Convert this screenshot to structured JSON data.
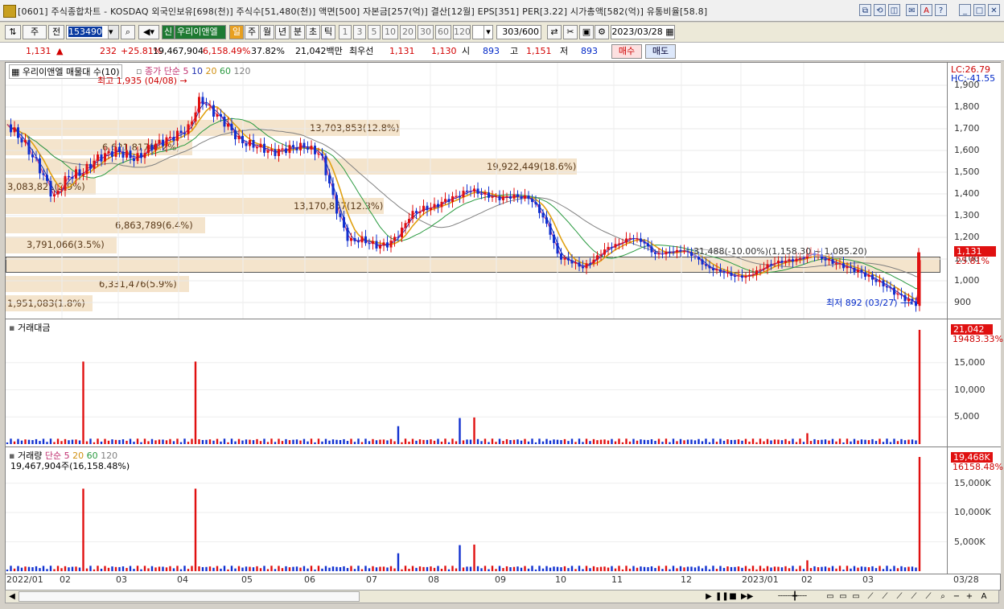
{
  "window": {
    "title": "[0601] 주식종합차트 - KOSDAQ 외국인보유[698(천)] 주식수[51,480(천)] 액면[500] 자본금[257(억)] 결산[12월] EPS[351] PER[3.22] 시가총액[582(억)] 유통비율[58.8]",
    "buttons": [
      "⧉",
      "⟲",
      "◫",
      "✉",
      "A",
      "?",
      "_",
      "□",
      "✕"
    ]
  },
  "toolbar": {
    "market": "주",
    "prev": "전",
    "code": "153490",
    "stock_name": "우리이앤엘",
    "new_badge": "신",
    "periods": [
      "일",
      "주",
      "월",
      "년",
      "분",
      "초",
      "틱"
    ],
    "selected_period": "일",
    "numbers": [
      "1",
      "3",
      "5",
      "10",
      "20",
      "30",
      "60",
      "120"
    ],
    "count": "303",
    "count_total": "/600",
    "date": "2023/03/28"
  },
  "quote": {
    "price": "1,131",
    "arrow": "▲",
    "change": "232",
    "change_pct": "+25.81%",
    "volume": "19,467,904",
    "volume_ratio": "6,158.49%",
    "turnover": "37.82%",
    "amount": "21,042백만",
    "best_ask_label": "최우선",
    "best_ask": "1,131",
    "best_bid": "1,130",
    "open_label": "시",
    "open": "893",
    "high_label": "고",
    "high": "1,151",
    "low_label": "저",
    "low": "893",
    "buy_btn": "매수",
    "sell_btn": "매도"
  },
  "price_panel": {
    "title": "우리이앤엘 매물대 수(10)",
    "ma_label": "종가 단순",
    "ma_periods": [
      "5",
      "10",
      "20",
      "60",
      "120"
    ],
    "lc": "LC:26.79",
    "hc": "HC:-41.55",
    "high_note": "최고 1,935 (04/08)",
    "low_note": "최저 892 (03/27)",
    "range_note": "31,488(-10.00%)(1,158.30 ~ 1,085.20)",
    "current_badge": "1,131",
    "current_pct": "25.81%",
    "yticks": [
      "1,900",
      "1,800",
      "1,700",
      "1,600",
      "1,500",
      "1,400",
      "1,300",
      "1,200",
      "1,100",
      "1,000",
      "900"
    ],
    "volume_profile": [
      {
        "label": "1,951,083(1.8%)",
        "price_from": 850,
        "price_to": 940
      },
      {
        "label": "6,331,476(5.9%)",
        "price_from": 940,
        "price_to": 1030
      },
      {
        "label": "31,488(29.4%)",
        "price_from": 1030,
        "price_to": 1120
      },
      {
        "label": "3,791,066(3.5%)",
        "price_from": 1120,
        "price_to": 1210
      },
      {
        "label": "6,863,789(6.4%)",
        "price_from": 1210,
        "price_to": 1300
      },
      {
        "label": "13,170,857(12.3%)",
        "price_from": 1300,
        "price_to": 1390
      },
      {
        "label": "3,083,821(2.9%)",
        "price_from": 1390,
        "price_to": 1480
      },
      {
        "label": "19,922,449(18.6%)",
        "price_from": 1480,
        "price_to": 1570
      },
      {
        "label": "6,621,817(6.2%)",
        "price_from": 1570,
        "price_to": 1660
      },
      {
        "label": "13,703,853(12.8%)",
        "price_from": 1660,
        "price_to": 1750
      }
    ]
  },
  "amount_panel": {
    "title": "거래대금",
    "yticks": [
      "15,000",
      "10,000",
      "5,000"
    ],
    "badge": "21,042",
    "sub": "19483.33%"
  },
  "volume_panel": {
    "title": "거래량",
    "ma_label": "단순",
    "ma_periods": [
      "5",
      "20",
      "60",
      "120"
    ],
    "summary": "19,467,904주(16,158.48%)",
    "yticks": [
      "15,000K",
      "10,000K",
      "5,000K"
    ],
    "badge": "19,468K",
    "sub": "16158.48%"
  },
  "xaxis": [
    "2022/01",
    "02",
    "03",
    "04",
    "05",
    "06",
    "07",
    "08",
    "09",
    "10",
    "11",
    "12",
    "2023/01",
    "02",
    "03",
    "03/28"
  ],
  "colors": {
    "up": "#e01010",
    "down": "#1030d0",
    "ma5": "#d03080",
    "ma10": "#2030b0",
    "ma20": "#e0a010",
    "ma60": "#2a9a40",
    "ma120": "#808080",
    "profile": "#f4e4cc"
  }
}
